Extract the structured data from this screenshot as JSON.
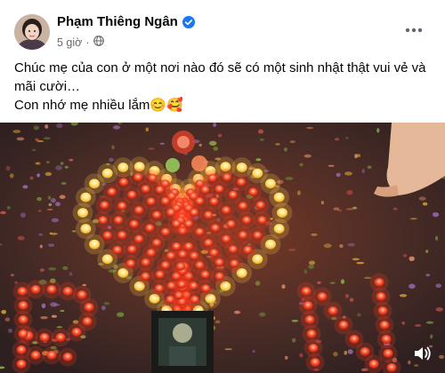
{
  "post": {
    "author_name": "Phạm Thiêng Ngân",
    "verified_icon": "verified-badge-icon",
    "time": "5 giờ",
    "separator": "·",
    "audience_icon": "globe-icon",
    "more_icon": "more-horizontal-icon",
    "caption_line_1": "Chúc mẹ của con ở một nơi nào đó sẽ có một sinh nhật thật vui vẻ và mãi cười…",
    "caption_line_2": "Con nhớ mẹ nhiều lắm😊🥰",
    "media_description_icon": "video-thumbnail",
    "sound_icon": "speaker-icon",
    "colors": {
      "verified": "#1877f2",
      "text": "#050505",
      "meta": "#65676b",
      "candle_red": "#e0301e",
      "candle_yellow": "#ffd23c"
    }
  }
}
